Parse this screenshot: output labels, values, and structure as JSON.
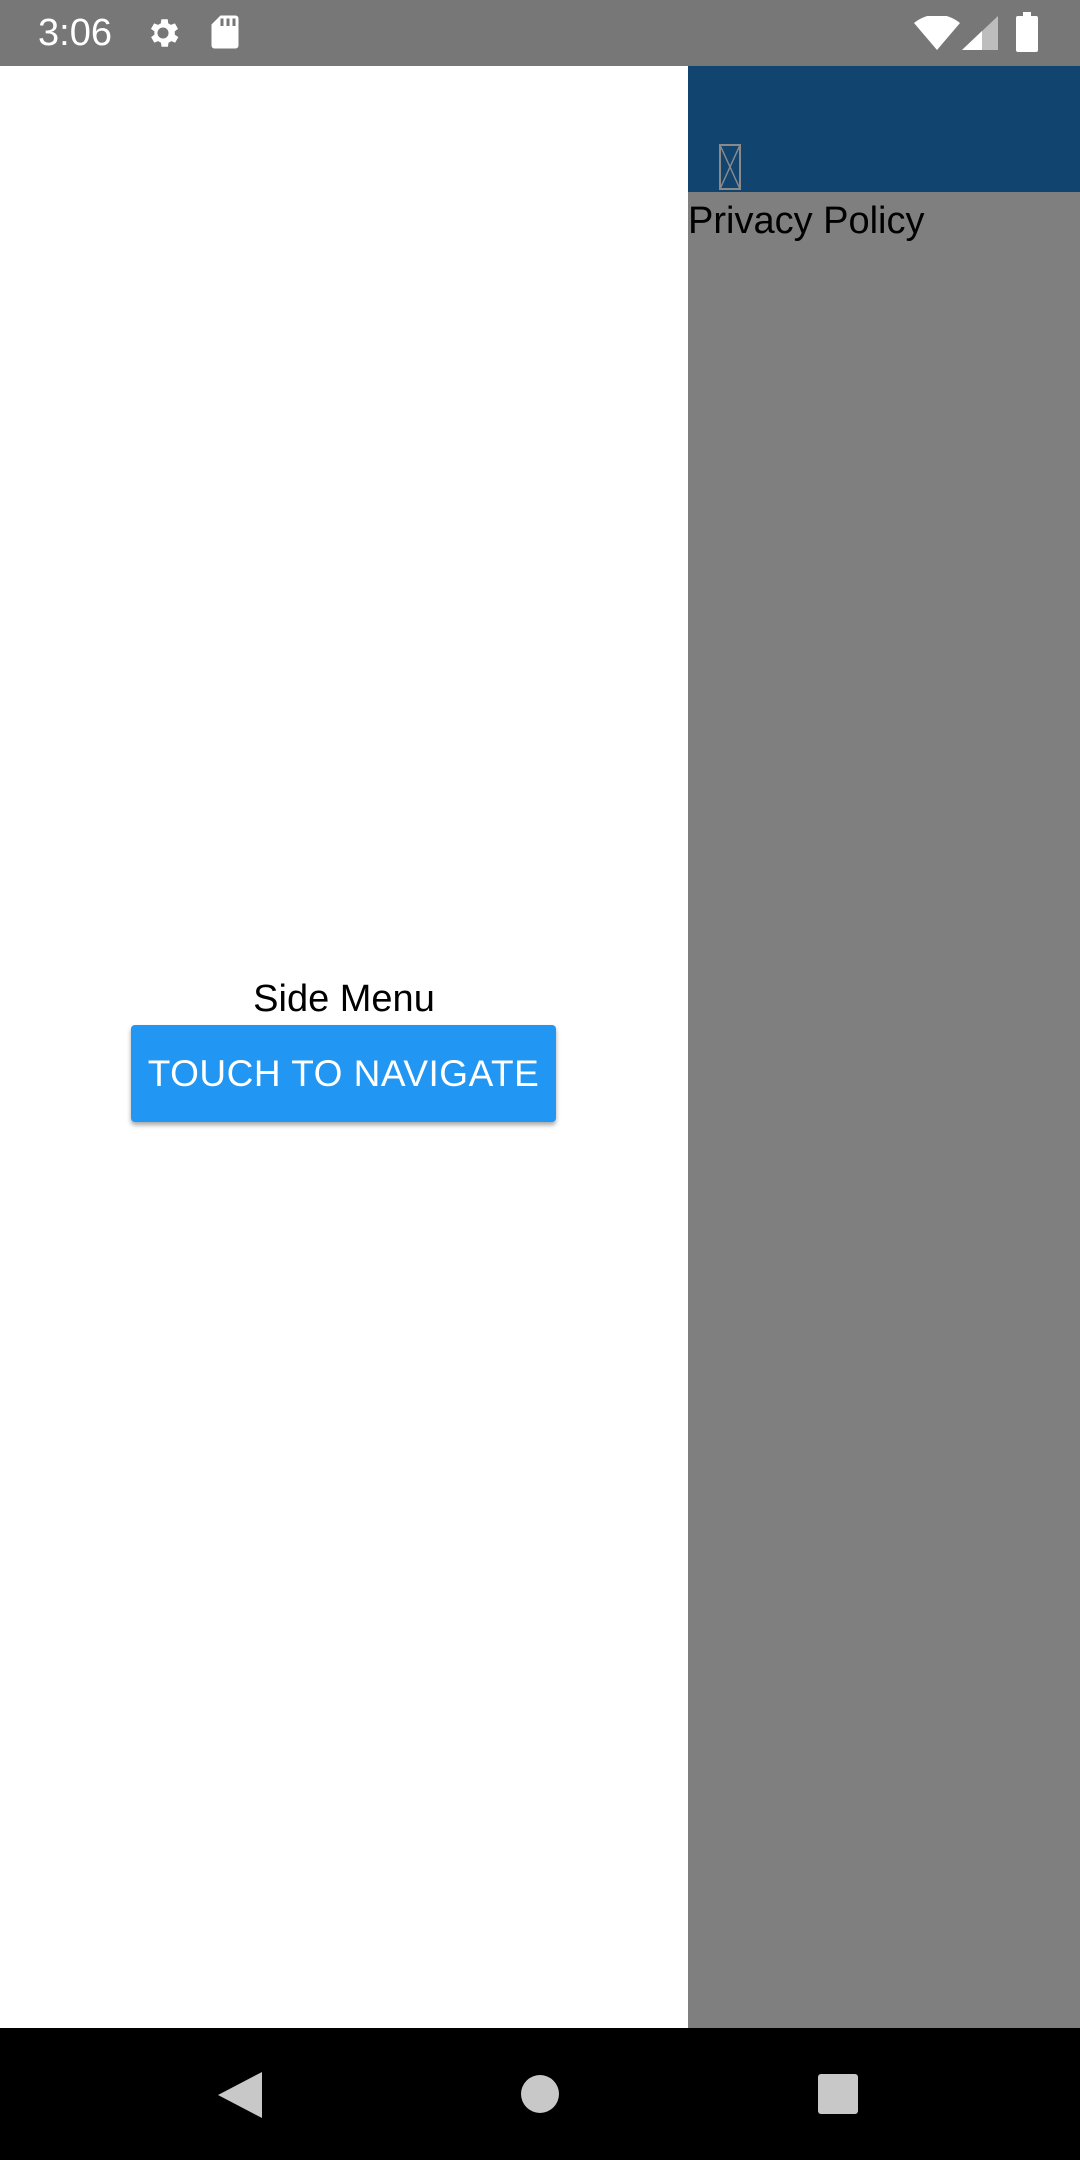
{
  "status_bar": {
    "time": "3:06",
    "icons": [
      "gear-icon",
      "sd-card-icon",
      "wifi-icon",
      "signal-icon",
      "battery-icon"
    ]
  },
  "drawer": {
    "title": "Side Menu",
    "button_label": "TOUCH TO NAVIGATE",
    "button_color": "#2196f3"
  },
  "main": {
    "header_color": "#11446e",
    "header_icon": "broken-image-icon",
    "title": "Privacy Policy",
    "scrim_color": "#7f7f7f"
  },
  "nav_bar": {
    "buttons": [
      "back-icon",
      "home-icon",
      "recents-icon"
    ]
  }
}
